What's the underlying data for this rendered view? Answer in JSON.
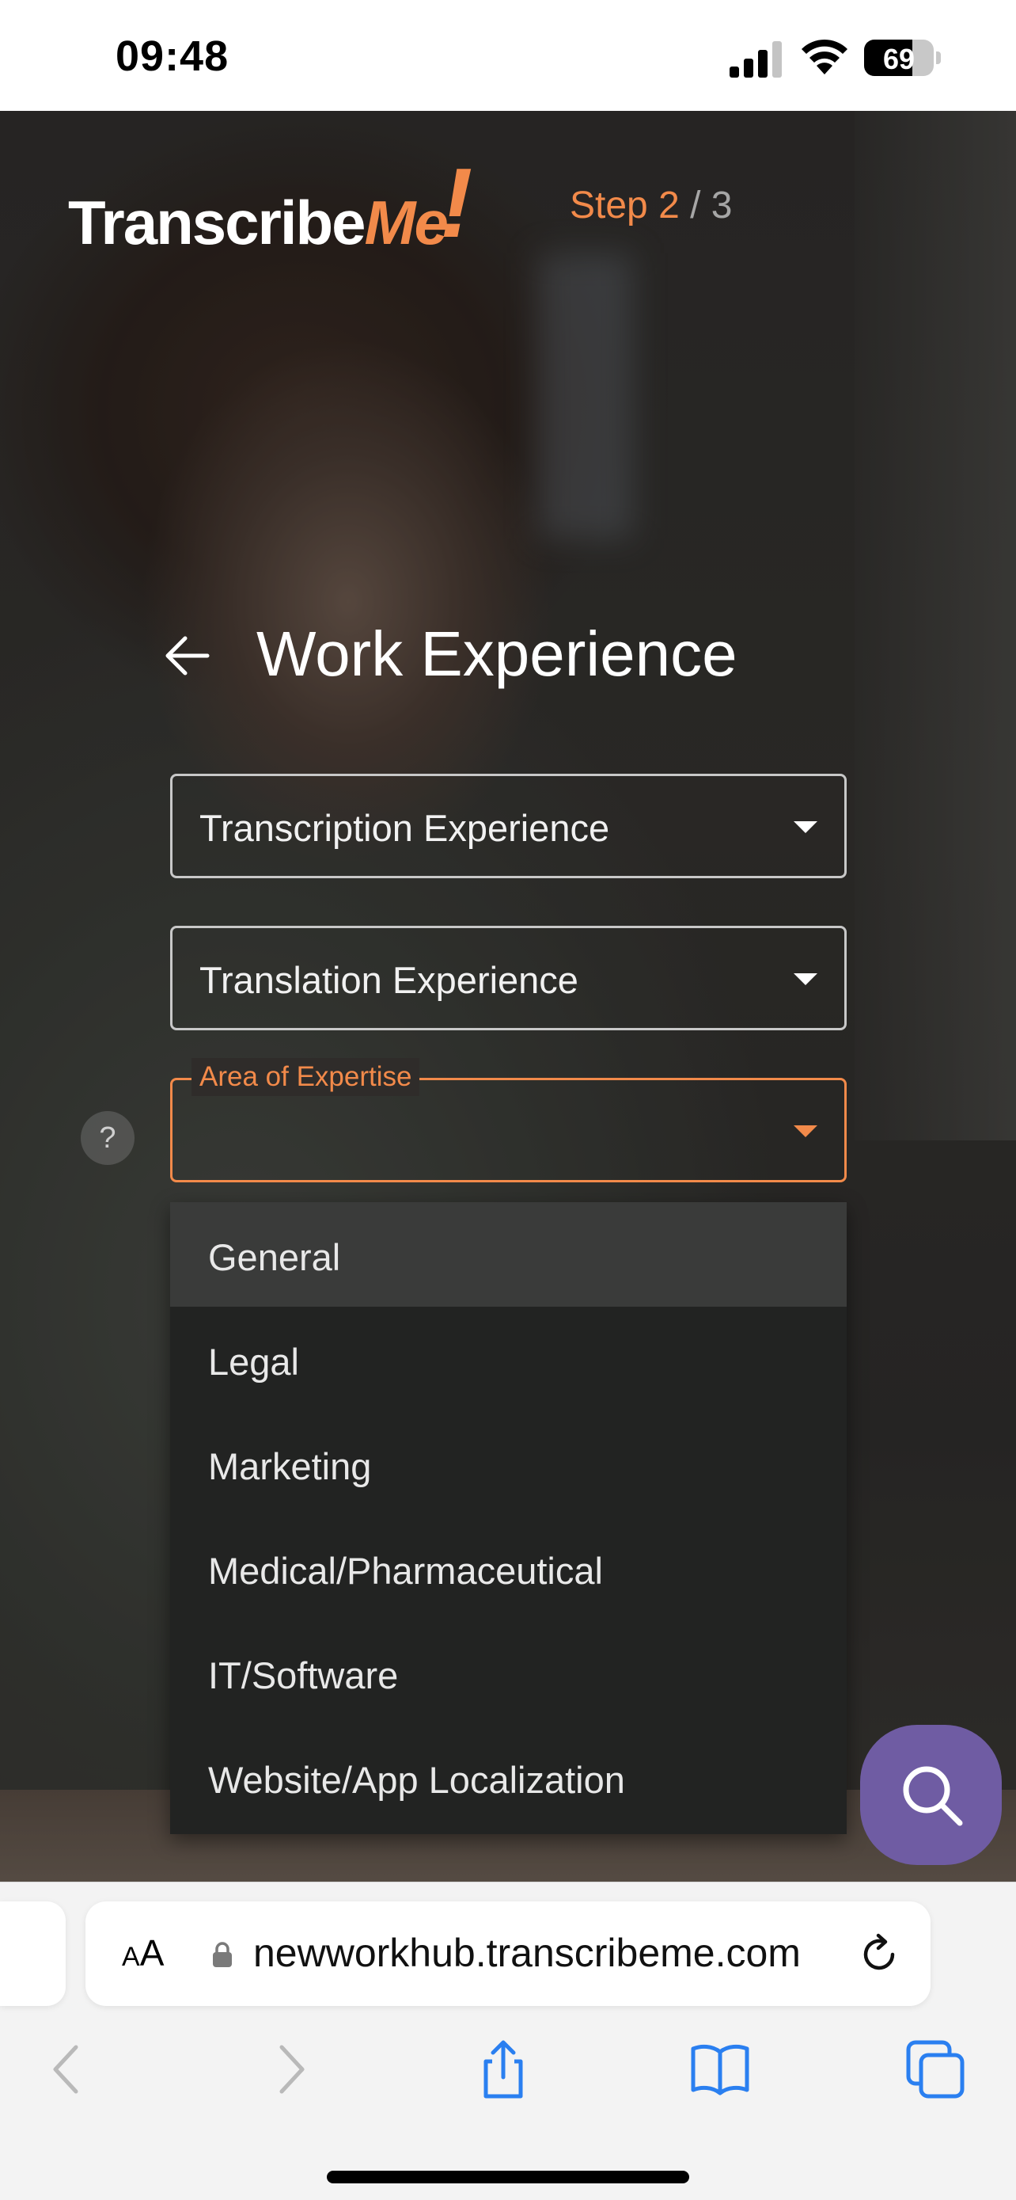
{
  "status_bar": {
    "time": "09:48",
    "battery": "69",
    "battery_level": 0.69
  },
  "header": {
    "logo_part1": "Transcribe",
    "logo_part2": "Me",
    "logo_part3": "!",
    "step_current": "Step 2",
    "step_total": " / 3"
  },
  "page": {
    "title": "Work Experience"
  },
  "fields": {
    "transcription": {
      "label": "Transcription Experience"
    },
    "translation": {
      "label": "Translation Experience"
    },
    "expertise": {
      "label": "Area of Expertise",
      "value": ""
    }
  },
  "help": {
    "label": "?"
  },
  "dropdown": {
    "options": [
      {
        "label": "General",
        "highlighted": true
      },
      {
        "label": "Legal"
      },
      {
        "label": "Marketing"
      },
      {
        "label": "Medical/Pharmaceutical"
      },
      {
        "label": "IT/Software"
      },
      {
        "label": "Website/App Localization"
      }
    ]
  },
  "browser": {
    "text_size_label_small": "A",
    "text_size_label_large": "A",
    "url": "newworkhub.transcribeme.com"
  },
  "colors": {
    "accent": "#f28a4a",
    "fab": "#6f5ca3",
    "menu_bg": "#222322",
    "menu_highlight": "#3a3b3a",
    "browser_blue": "#2a7ff0"
  },
  "icons": {
    "fab": "search-icon",
    "back": "arrow-left-icon",
    "caret": "caret-down-icon",
    "browser_back": "chevron-left-icon",
    "browser_forward": "chevron-right-icon",
    "share": "share-icon",
    "bookmarks": "book-icon",
    "tabs": "tabs-icon",
    "reload": "reload-icon",
    "lock": "lock-icon"
  }
}
